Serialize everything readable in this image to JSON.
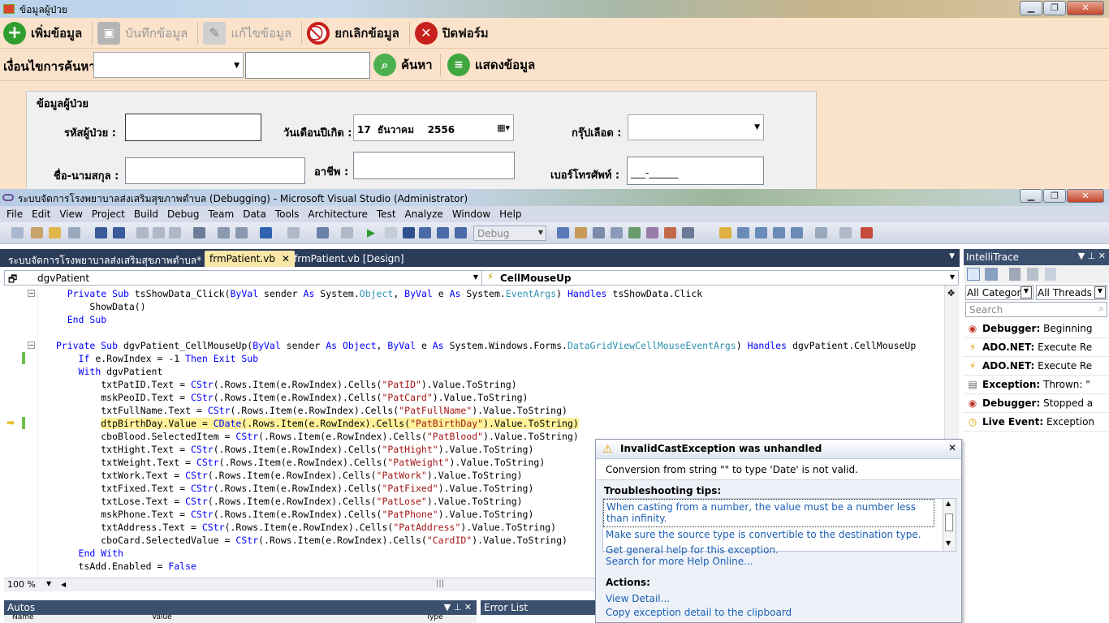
{
  "app": {
    "title": "ข้อมูลผู้ป่วย",
    "window_controls": {
      "minimize": "▁",
      "maximize": "❐",
      "close": "✕"
    },
    "toolbar": [
      {
        "label": "เพิ่มข้อมูล",
        "enabled": true,
        "icon": "add-icon",
        "color": "#2f9e2f"
      },
      {
        "label": "บันทึกข้อมูล",
        "enabled": false,
        "icon": "save-icon",
        "color": "#a0a0a0"
      },
      {
        "label": "แก้ไขข้อมูล",
        "enabled": false,
        "icon": "edit-icon",
        "color": "#b0b0b0"
      },
      {
        "label": "ยกเลิกข้อมูล",
        "enabled": true,
        "icon": "cancel-icon",
        "color": "#c8201c"
      },
      {
        "label": "ปิดฟอร์ม",
        "enabled": true,
        "icon": "close-form-icon",
        "color": "#c8201c"
      }
    ],
    "search": {
      "condition_label": "เงื่อนไขการค้นหา",
      "condition_value": "",
      "keyword_value": "",
      "search_label": "ค้นหา",
      "show_label": "แสดงข้อมูล"
    },
    "group": {
      "title": "ข้อมูลผู้ป่วย",
      "patient_id_label": "รหัสผู้ป่วย :",
      "patient_id_value": "",
      "birthdate_label": "วันเดือนปีเกิด :",
      "birthdate_value": "17  ธันวาคม    2556",
      "blood_label": "กรุ๊ปเลือด :",
      "blood_value": "",
      "name_label": "ชื่อ-นามสกุล :",
      "name_value": "",
      "job_label": "อาชีพ :",
      "job_value": "",
      "phone_label": "เบอร์โทรศัพท์ :",
      "phone_value": "___-______"
    }
  },
  "vs": {
    "title": "ระบบจัดการโรงพยาบาลส่งเสริมสุขภาพตำบล (Debugging) - Microsoft Visual Studio (Administrator)",
    "menu": [
      "File",
      "Edit",
      "View",
      "Project",
      "Build",
      "Debug",
      "Team",
      "Data",
      "Tools",
      "Architecture",
      "Test",
      "Analyze",
      "Window",
      "Help"
    ],
    "config": "Debug",
    "tabs": [
      "ระบบจัดการโรงพยาบาลส่งเสริมสุขภาพตำบล*",
      "frmPatient.vb",
      "frmPatient.vb [Design]"
    ],
    "nav_left": "dgvPatient",
    "nav_right": "CellMouseUp",
    "zoom": "100 %",
    "autos_title": "Autos",
    "autos_cols": [
      "Name",
      "Value",
      "Type"
    ],
    "errors_title": "Error List",
    "code": [
      {
        "indent": "    ",
        "parts": [
          [
            "kw",
            "Private Sub "
          ],
          [
            "",
            "tsShowData_Click("
          ],
          [
            "kw",
            "ByVal "
          ],
          [
            "",
            "sender "
          ],
          [
            "kw",
            "As "
          ],
          [
            "",
            "System."
          ],
          [
            "ty",
            "Object"
          ],
          [
            "",
            ", "
          ],
          [
            "kw",
            "ByVal "
          ],
          [
            "",
            "e "
          ],
          [
            "kw",
            "As "
          ],
          [
            "",
            "System."
          ],
          [
            "ty",
            "EventArgs"
          ],
          [
            "",
            ") "
          ],
          [
            "kw",
            "Handles "
          ],
          [
            "",
            "tsShowData.Click"
          ]
        ]
      },
      {
        "indent": "        ",
        "parts": [
          [
            "",
            "ShowData()"
          ]
        ]
      },
      {
        "indent": "    ",
        "parts": [
          [
            "kw",
            "End Sub"
          ]
        ]
      },
      {
        "indent": "",
        "parts": [
          [
            "",
            ""
          ]
        ]
      },
      {
        "indent": "  ",
        "parts": [
          [
            "kw",
            "Private Sub "
          ],
          [
            "",
            "dgvPatient_CellMouseUp("
          ],
          [
            "kw",
            "ByVal "
          ],
          [
            "",
            "sender "
          ],
          [
            "kw",
            "As Object"
          ],
          [
            "",
            ", "
          ],
          [
            "kw",
            "ByVal "
          ],
          [
            "",
            "e "
          ],
          [
            "kw",
            "As "
          ],
          [
            "",
            "System.Windows.Forms."
          ],
          [
            "ty",
            "DataGridViewCellMouseEventArgs"
          ],
          [
            "",
            ") "
          ],
          [
            "kw",
            "Handles "
          ],
          [
            "",
            "dgvPatient.CellMouseUp"
          ]
        ]
      },
      {
        "indent": "      ",
        "parts": [
          [
            "kw",
            "If "
          ],
          [
            "",
            "e.RowIndex = -1 "
          ],
          [
            "kw",
            "Then Exit Sub"
          ]
        ]
      },
      {
        "indent": "      ",
        "parts": [
          [
            "kw",
            "With "
          ],
          [
            "",
            "dgvPatient"
          ]
        ]
      },
      {
        "indent": "          ",
        "parts": [
          [
            "",
            "txtPatID.Text = "
          ],
          [
            "kw",
            "CStr"
          ],
          [
            "",
            "(.Rows.Item(e.RowIndex).Cells("
          ],
          [
            "st",
            "\"PatID\""
          ],
          [
            "",
            ").Value.ToString)"
          ]
        ]
      },
      {
        "indent": "          ",
        "parts": [
          [
            "",
            "mskPeoID.Text = "
          ],
          [
            "kw",
            "CStr"
          ],
          [
            "",
            "(.Rows.Item(e.RowIndex).Cells("
          ],
          [
            "st",
            "\"PatCard\""
          ],
          [
            "",
            ").Value.ToString)"
          ]
        ]
      },
      {
        "indent": "          ",
        "parts": [
          [
            "",
            "txtFullName.Text = "
          ],
          [
            "kw",
            "CStr"
          ],
          [
            "",
            "(.Rows.Item(e.RowIndex).Cells("
          ],
          [
            "st",
            "\"PatFullName\""
          ],
          [
            "",
            ").Value.ToString)"
          ]
        ]
      },
      {
        "indent": "          ",
        "hl": true,
        "parts": [
          [
            "",
            "dtpBirthDay.Value = "
          ],
          [
            "kw",
            "CDate"
          ],
          [
            "",
            "(.Rows.Item(e.RowIndex).Cells("
          ],
          [
            "st",
            "\"PatBirthDay\""
          ],
          [
            "",
            ").Value.ToString)"
          ]
        ]
      },
      {
        "indent": "          ",
        "parts": [
          [
            "",
            "cboBlood.SelectedItem = "
          ],
          [
            "kw",
            "CStr"
          ],
          [
            "",
            "(.Rows.Item(e.RowIndex).Cells("
          ],
          [
            "st",
            "\"PatBlood\""
          ],
          [
            "",
            ").Value.ToString)"
          ]
        ]
      },
      {
        "indent": "          ",
        "parts": [
          [
            "",
            "txtHight.Text = "
          ],
          [
            "kw",
            "CStr"
          ],
          [
            "",
            "(.Rows.Item(e.RowIndex).Cells("
          ],
          [
            "st",
            "\"PatHight\""
          ],
          [
            "",
            ").Value.ToString)"
          ]
        ]
      },
      {
        "indent": "          ",
        "parts": [
          [
            "",
            "txtWeight.Text = "
          ],
          [
            "kw",
            "CStr"
          ],
          [
            "",
            "(.Rows.Item(e.RowIndex).Cells("
          ],
          [
            "st",
            "\"PatWeight\""
          ],
          [
            "",
            ").Value.ToString)"
          ]
        ]
      },
      {
        "indent": "          ",
        "parts": [
          [
            "",
            "txtWork.Text = "
          ],
          [
            "kw",
            "CStr"
          ],
          [
            "",
            "(.Rows.Item(e.RowIndex).Cells("
          ],
          [
            "st",
            "\"PatWork\""
          ],
          [
            "",
            ").Value.ToString)"
          ]
        ]
      },
      {
        "indent": "          ",
        "parts": [
          [
            "",
            "txtFixed.Text = "
          ],
          [
            "kw",
            "CStr"
          ],
          [
            "",
            "(.Rows.Item(e.RowIndex).Cells("
          ],
          [
            "st",
            "\"PatFixed\""
          ],
          [
            "",
            ").Value.ToString)"
          ]
        ]
      },
      {
        "indent": "          ",
        "parts": [
          [
            "",
            "txtLose.Text = "
          ],
          [
            "kw",
            "CStr"
          ],
          [
            "",
            "(.Rows.Item(e.RowIndex).Cells("
          ],
          [
            "st",
            "\"PatLose\""
          ],
          [
            "",
            ").Value.ToString)"
          ]
        ]
      },
      {
        "indent": "          ",
        "parts": [
          [
            "",
            "mskPhone.Text = "
          ],
          [
            "kw",
            "CStr"
          ],
          [
            "",
            "(.Rows.Item(e.RowIndex).Cells("
          ],
          [
            "st",
            "\"PatPhone\""
          ],
          [
            "",
            ").Value.ToString)"
          ]
        ]
      },
      {
        "indent": "          ",
        "parts": [
          [
            "",
            "txtAddress.Text = "
          ],
          [
            "kw",
            "CStr"
          ],
          [
            "",
            "(.Rows.Item(e.RowIndex).Cells("
          ],
          [
            "st",
            "\"PatAddress\""
          ],
          [
            "",
            ").Value.ToString)"
          ]
        ]
      },
      {
        "indent": "          ",
        "parts": [
          [
            "",
            "cboCard.SelectedValue = "
          ],
          [
            "kw",
            "CStr"
          ],
          [
            "",
            "(.Rows.Item(e.RowIndex).Cells("
          ],
          [
            "st",
            "\"CardID\""
          ],
          [
            "",
            ").Value.ToString)"
          ]
        ]
      },
      {
        "indent": "      ",
        "parts": [
          [
            "kw",
            "End With"
          ]
        ]
      },
      {
        "indent": "      ",
        "parts": [
          [
            "",
            "tsAdd.Enabled = "
          ],
          [
            "kw",
            "False"
          ]
        ]
      }
    ],
    "intellitrace": {
      "title": "IntelliTrace",
      "filter_category": "All Categor",
      "filter_threads": "All Threads",
      "search_placeholder": "Search",
      "events": [
        {
          "kind": "Debugger:",
          "text": " Beginning",
          "icon": "debugger-icon",
          "color": "#c0392b"
        },
        {
          "kind": "ADO.NET:",
          "text": " Execute Re",
          "icon": "lightning-icon",
          "color": "#e0a000"
        },
        {
          "kind": "ADO.NET:",
          "text": " Execute Re",
          "icon": "lightning-icon",
          "color": "#e0a000"
        },
        {
          "kind": "Exception:",
          "text": " Thrown: \"",
          "icon": "exception-icon",
          "color": "#666"
        },
        {
          "kind": "Debugger:",
          "text": " Stopped a",
          "icon": "debugger-icon",
          "color": "#c0392b"
        },
        {
          "kind": "Live Event:",
          "text": " Exception",
          "icon": "live-event-icon",
          "color": "#d4a000"
        }
      ]
    },
    "exception": {
      "title": "InvalidCastException was unhandled",
      "message": "Conversion from string \"\" to type 'Date' is not valid.",
      "tips_title": "Troubleshooting tips:",
      "tips": [
        "When casting from a number, the value must be a number less than infinity.",
        "Make sure the source type is convertible to the destination type.",
        "Get general help for this exception."
      ],
      "search_link": "Search for more Help Online...",
      "actions_title": "Actions:",
      "actions": [
        "View Detail...",
        "Copy exception detail to the clipboard"
      ]
    }
  }
}
